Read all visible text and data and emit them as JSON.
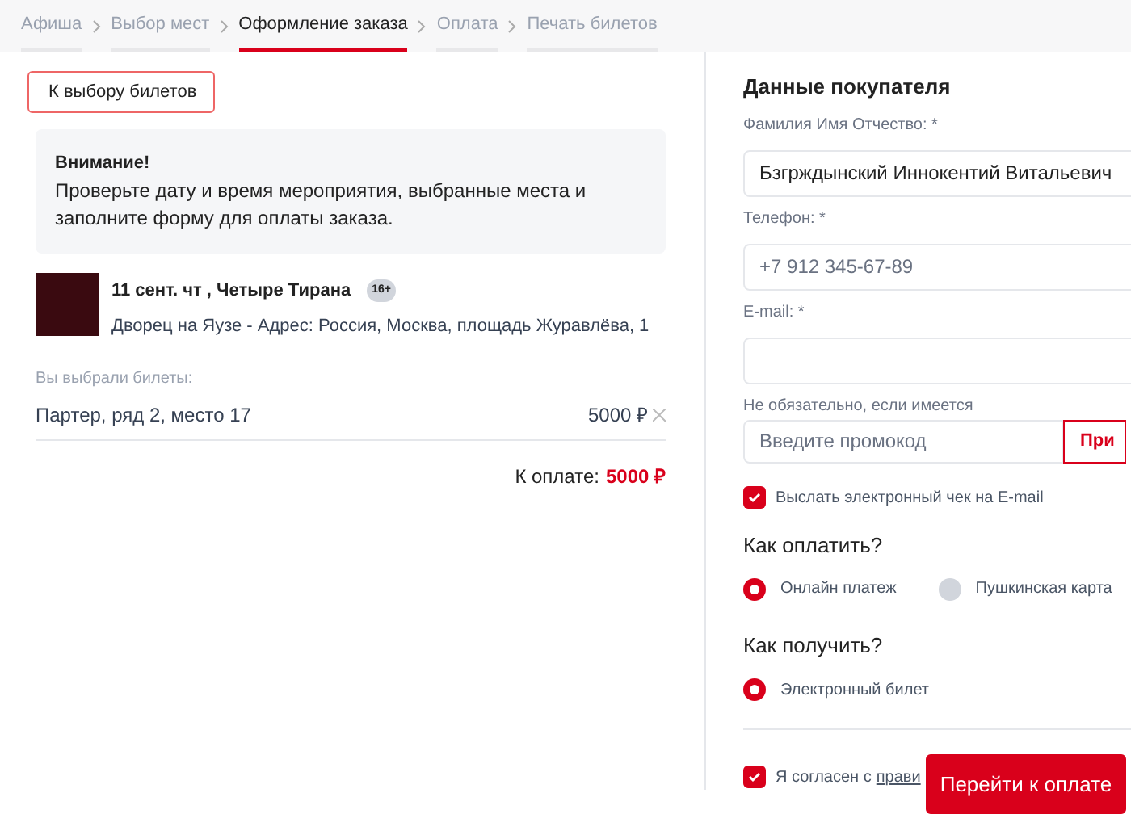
{
  "steps": [
    {
      "label": "Афиша",
      "selected": false
    },
    {
      "label": "Выбор мест",
      "selected": false
    },
    {
      "label": "Оформление заказа",
      "selected": true
    },
    {
      "label": "Оплата",
      "selected": false
    },
    {
      "label": "Печать билетов",
      "selected": false
    }
  ],
  "back_button": "К выбору билетов",
  "notice": {
    "title": "Внимание!",
    "text": "Проверьте дату и время мероприятия, выбранные места и заполните форму для оплаты заказа."
  },
  "event": {
    "title": "11 сент. чт , Четыре Тирана",
    "age": "16+",
    "venue": "Дворец на Яузе - Адрес: Россия, Москва, площадь Журавлёва, 1"
  },
  "tickets_label": "Вы выбрали билеты:",
  "tickets": [
    {
      "seat": "Партер, ряд 2, место 17",
      "price": "5000 ₽"
    }
  ],
  "total": {
    "label": "К оплате:",
    "value": "5000 ₽"
  },
  "buyer": {
    "title": "Данные покупателя",
    "fields": [
      {
        "label": "Фамилия Имя Отчество: *",
        "value": "Бзгрждынский Иннокентий Витальевич"
      },
      {
        "label": "Телефон: *",
        "placeholder": "+7 912 345-67-89"
      },
      {
        "label": "E-mail: *"
      }
    ],
    "promo": {
      "label": "Не обязательно, если имеется",
      "placeholder": "Введите промокод",
      "button": "При"
    },
    "receipt": {
      "label": "Выслать электронный чек на E-mail",
      "checked": true
    }
  },
  "payment": {
    "title": "Как оплатить?",
    "options": [
      {
        "label": "Онлайн платеж",
        "selected": true
      },
      {
        "label": "Пушкинская карта",
        "selected": false
      }
    ]
  },
  "delivery": {
    "title": "Как получить?",
    "options": [
      {
        "label": "Электронный билет",
        "selected": true
      }
    ]
  },
  "agreement": {
    "text": "Я согласен с",
    "link": "прави",
    "checked": true
  },
  "submit": "Перейти к оплате"
}
